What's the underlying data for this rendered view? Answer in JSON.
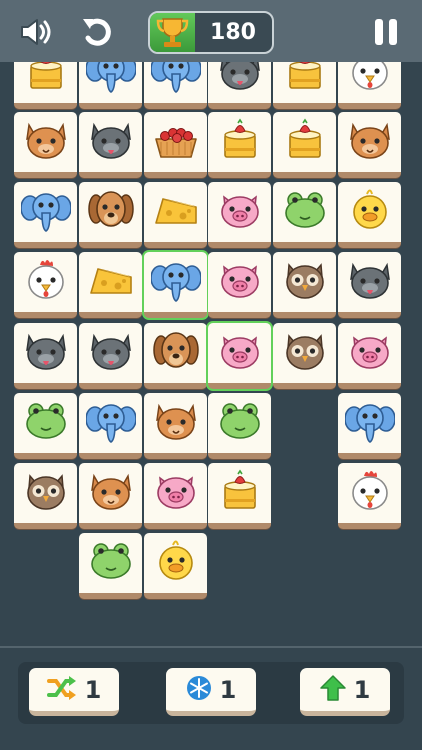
{
  "score": "180",
  "powerups": {
    "shuffle": "1",
    "freeze": "1",
    "undo_up": "1"
  },
  "colors": {
    "background": "#34454f",
    "topbar": "#5a6a74",
    "tile": "#fdfaf0",
    "selected_outline": "#62d05a"
  },
  "tiles": [
    {
      "col": 0,
      "row": 0,
      "kind": "cake"
    },
    {
      "col": 1,
      "row": 0,
      "kind": "elephant"
    },
    {
      "col": 2,
      "row": 0,
      "kind": "elephant"
    },
    {
      "col": 3,
      "row": 0,
      "kind": "gray-cat"
    },
    {
      "col": 4,
      "row": 0,
      "kind": "cake"
    },
    {
      "col": 5,
      "row": 0,
      "kind": "chicken"
    },
    {
      "col": 0,
      "row": 1,
      "kind": "orange-cat"
    },
    {
      "col": 1,
      "row": 1,
      "kind": "gray-cat"
    },
    {
      "col": 2,
      "row": 1,
      "kind": "cherry-tart"
    },
    {
      "col": 3,
      "row": 1,
      "kind": "cake"
    },
    {
      "col": 4,
      "row": 1,
      "kind": "cake"
    },
    {
      "col": 5,
      "row": 1,
      "kind": "orange-cat"
    },
    {
      "col": 0,
      "row": 2,
      "kind": "elephant"
    },
    {
      "col": 1,
      "row": 2,
      "kind": "dog"
    },
    {
      "col": 2,
      "row": 2,
      "kind": "cheese"
    },
    {
      "col": 3,
      "row": 2,
      "kind": "pig"
    },
    {
      "col": 4,
      "row": 2,
      "kind": "frog"
    },
    {
      "col": 5,
      "row": 2,
      "kind": "chick"
    },
    {
      "col": 0,
      "row": 3,
      "kind": "chicken"
    },
    {
      "col": 1,
      "row": 3,
      "kind": "cheese"
    },
    {
      "col": 2,
      "row": 3,
      "kind": "elephant",
      "selected": true
    },
    {
      "col": 3,
      "row": 3,
      "kind": "pig"
    },
    {
      "col": 4,
      "row": 3,
      "kind": "owl"
    },
    {
      "col": 5,
      "row": 3,
      "kind": "gray-cat"
    },
    {
      "col": 0,
      "row": 4,
      "kind": "gray-cat"
    },
    {
      "col": 1,
      "row": 4,
      "kind": "gray-cat"
    },
    {
      "col": 2,
      "row": 4,
      "kind": "dog"
    },
    {
      "col": 3,
      "row": 4,
      "kind": "pig",
      "selected": true
    },
    {
      "col": 4,
      "row": 4,
      "kind": "owl"
    },
    {
      "col": 5,
      "row": 4,
      "kind": "pig"
    },
    {
      "col": 0,
      "row": 5,
      "kind": "frog"
    },
    {
      "col": 1,
      "row": 5,
      "kind": "elephant"
    },
    {
      "col": 2,
      "row": 5,
      "kind": "orange-cat"
    },
    {
      "col": 3,
      "row": 5,
      "kind": "frog"
    },
    {
      "col": 5,
      "row": 5,
      "kind": "elephant"
    },
    {
      "col": 0,
      "row": 6,
      "kind": "owl"
    },
    {
      "col": 1,
      "row": 6,
      "kind": "orange-cat"
    },
    {
      "col": 2,
      "row": 6,
      "kind": "pig"
    },
    {
      "col": 3,
      "row": 6,
      "kind": "cake"
    },
    {
      "col": 5,
      "row": 6,
      "kind": "chicken"
    },
    {
      "col": 1,
      "row": 7,
      "kind": "frog"
    },
    {
      "col": 2,
      "row": 7,
      "kind": "chick"
    }
  ]
}
